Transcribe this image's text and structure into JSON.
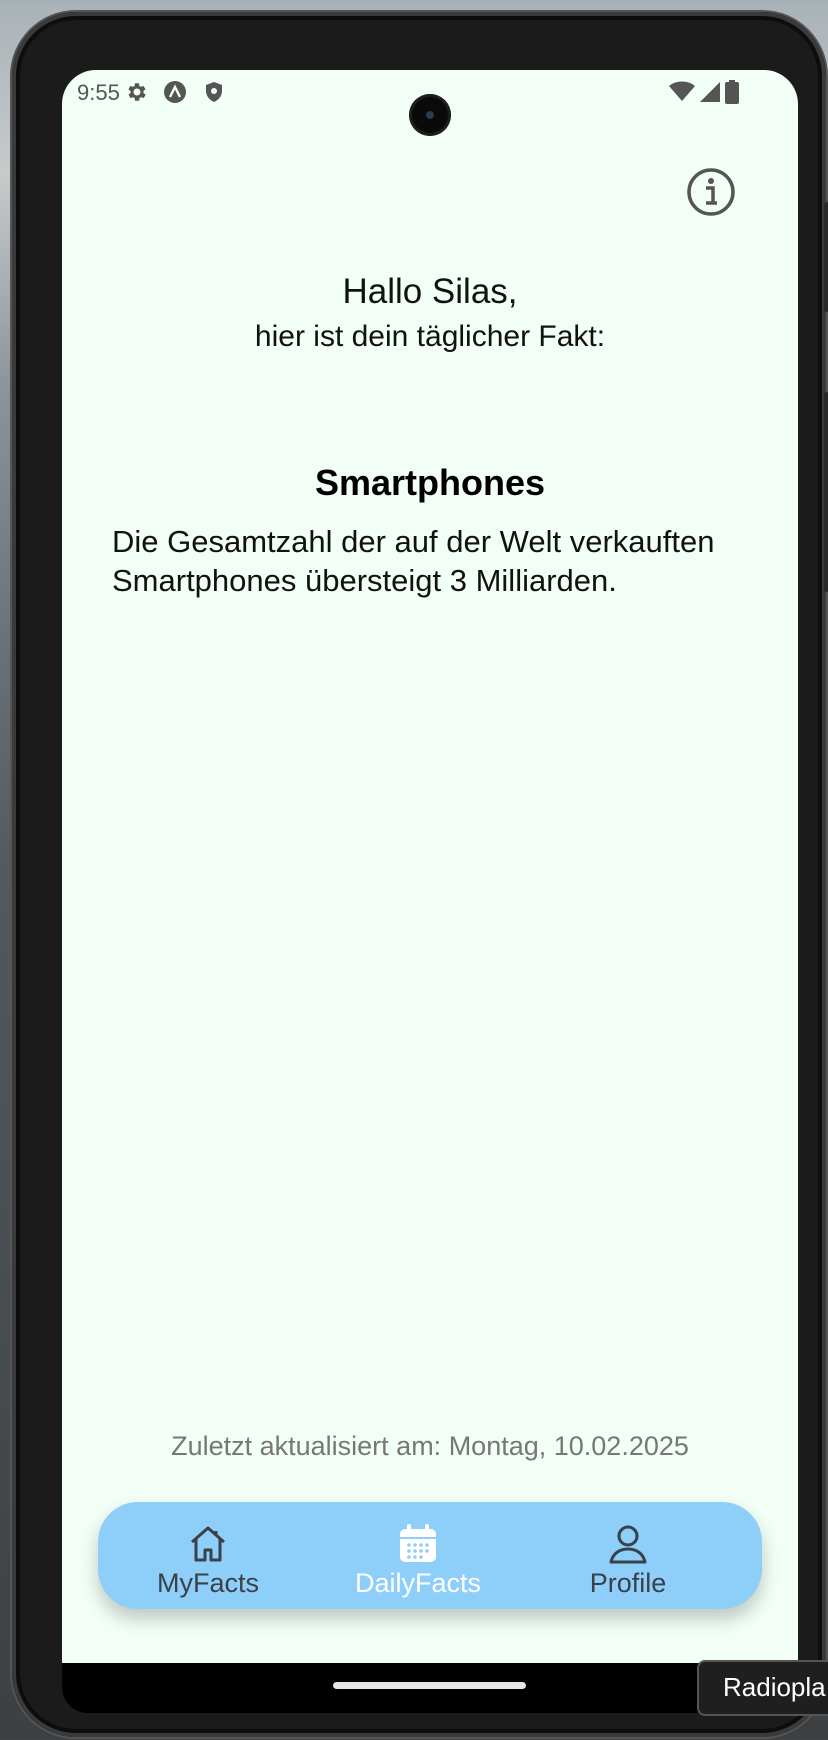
{
  "status_bar": {
    "time": "9:55",
    "left_icons": [
      "gear-icon",
      "a-circle-icon",
      "shield-icon"
    ],
    "right_icons": [
      "wifi-icon",
      "signal-icon",
      "battery-icon"
    ]
  },
  "header": {
    "info_icon": "info-circle-icon"
  },
  "greeting": {
    "line1": "Hallo Silas,",
    "line2": "hier ist dein täglicher Fakt:"
  },
  "fact": {
    "title": "Smartphones",
    "text": "Die Gesamtzahl der auf der Welt verkauften Smartphones übersteigt 3 Milliarden."
  },
  "footer": {
    "updated": "Zuletzt aktualisiert am: Montag, 10.02.2025"
  },
  "tabs": [
    {
      "label": "MyFacts",
      "icon": "home-icon",
      "active": false
    },
    {
      "label": "DailyFacts",
      "icon": "calendar-icon",
      "active": true
    },
    {
      "label": "Profile",
      "icon": "person-icon",
      "active": false
    }
  ],
  "tooltip": {
    "text": "Radiopla"
  },
  "colors": {
    "screen_background": "#f1fff6",
    "tabbar_background": "#8dcff9",
    "active_tab": "#ffffff",
    "inactive_tab": "#3a4148"
  }
}
